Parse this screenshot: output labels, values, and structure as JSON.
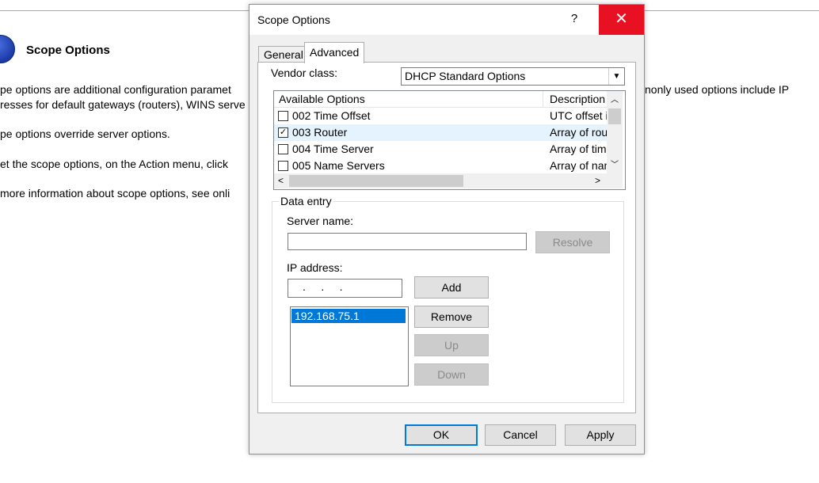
{
  "background": {
    "title": "Scope Options",
    "lines": [
      "pe options are additional configuration paramet",
      "resses for default gateways (routers), WINS serve",
      "pe options override server options.",
      "et the scope options, on the Action menu, click",
      "more information about scope options, see onli"
    ],
    "right_fragment": "nonly used options include IP"
  },
  "dialog": {
    "title": "Scope Options",
    "help": "?",
    "close": "✕",
    "tabs": {
      "general": "General",
      "advanced": "Advanced"
    },
    "vendor_class_label": "Vendor class:",
    "vendor_class_value": "DHCP Standard Options",
    "options_list": {
      "col_available": "Available Options",
      "col_description": "Description",
      "rows": [
        {
          "checked": false,
          "name": "002 Time Offset",
          "desc": "UTC offset i"
        },
        {
          "checked": true,
          "name": "003 Router",
          "desc": "Array of rout"
        },
        {
          "checked": false,
          "name": "004 Time Server",
          "desc": "Array of time"
        },
        {
          "checked": false,
          "name": "005 Name Servers",
          "desc": "Array of nam"
        }
      ]
    },
    "data_entry": {
      "legend": "Data entry",
      "server_name_label": "Server name:",
      "server_name_value": "",
      "resolve": "Resolve",
      "ip_label": "IP address:",
      "ip_value": ".     .     .",
      "add": "Add",
      "remove": "Remove",
      "up": "Up",
      "down": "Down",
      "ip_list": [
        "192.168.75.1"
      ]
    },
    "buttons": {
      "ok": "OK",
      "cancel": "Cancel",
      "apply": "Apply"
    }
  },
  "colors": {
    "close_red": "#e81123",
    "selection_blue": "#0078d7"
  }
}
